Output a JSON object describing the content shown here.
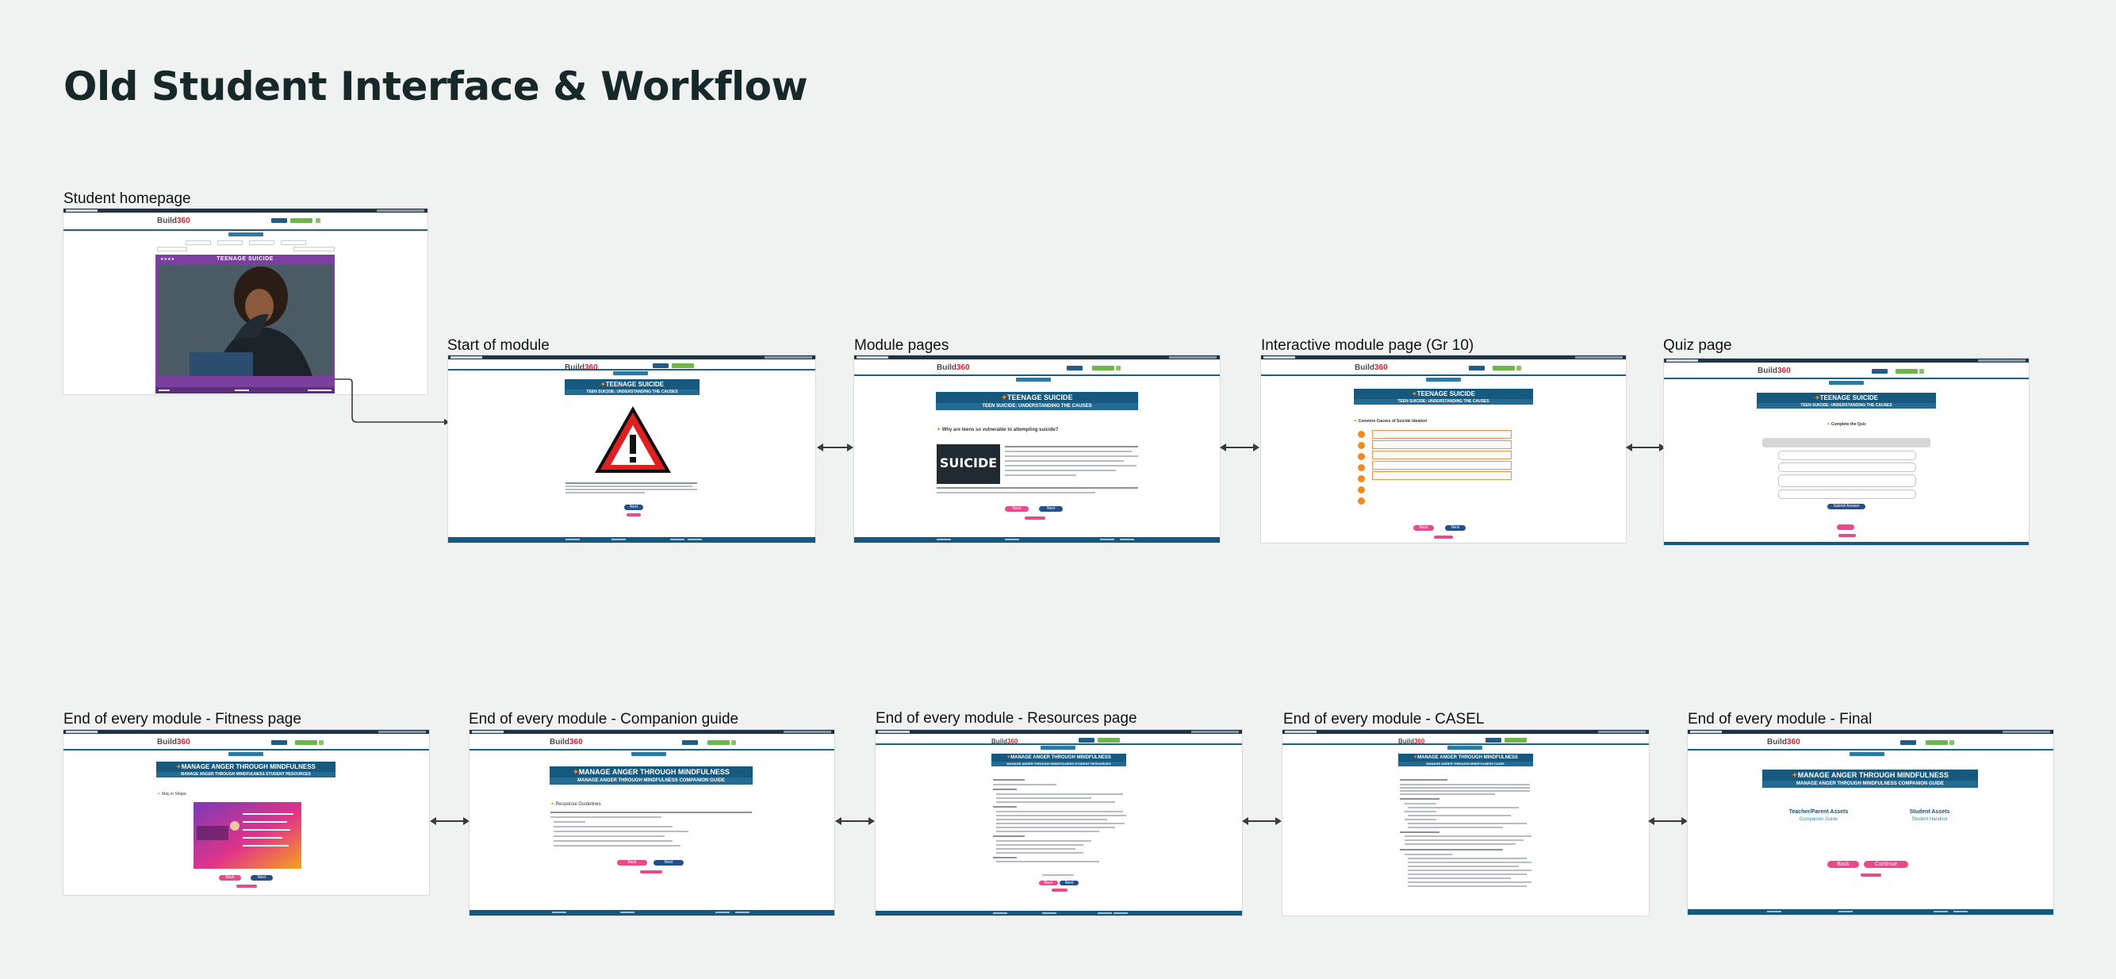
{
  "page": {
    "title": "Old Student Interface & Workflow"
  },
  "frames": [
    {
      "id": "student-homepage",
      "label": "Student homepage",
      "banner": "TEENAGE SUICIDE"
    },
    {
      "id": "start-of-module",
      "label": "Start of module",
      "banner": "TEENAGE SUICIDE",
      "sub": "TEEN SUICIDE: UNDERSTANDING THE CAUSES",
      "nav": [
        "Back",
        "Next"
      ]
    },
    {
      "id": "module-pages",
      "label": "Module pages",
      "banner": "TEENAGE SUICIDE",
      "sub": "TEEN SUICIDE: UNDERSTANDING THE CAUSES",
      "question": "Why are teens so vulnerable to attempting suicide?",
      "image_word": "SUICIDE",
      "nav": [
        "Back",
        "Next"
      ]
    },
    {
      "id": "interactive-module-page",
      "label": "Interactive module page (Gr 10)",
      "banner": "TEENAGE SUICIDE",
      "sub": "TEEN SUICIDE: UNDERSTANDING THE CAUSES",
      "heading": "Common Causes of Suicide Ideation",
      "nav": [
        "Back",
        "Next"
      ]
    },
    {
      "id": "quiz-page",
      "label": "Quiz page",
      "banner": "TEENAGE SUICIDE",
      "sub": "TEEN SUICIDE: UNDERSTANDING THE CAUSES",
      "heading": "Complete the Quiz",
      "submit": "Submit Answer"
    },
    {
      "id": "fitness-page",
      "label": "End of every module - Fitness page",
      "banner": "MANAGE ANGER THROUGH MINDFULNESS",
      "sub": "MANAGE ANGER THROUGH MINDFULNESS STUDENT RESOURCES",
      "heading": "Stay in Shape",
      "nav": [
        "Back",
        "Next"
      ]
    },
    {
      "id": "companion-guide",
      "label": "End of every module - Companion guide",
      "banner": "MANAGE ANGER THROUGH MINDFULNESS",
      "sub": "MANAGE ANGER THROUGH MINDFULNESS COMPANION GUIDE",
      "heading": "Response Guidelines",
      "nav": [
        "Back",
        "Next"
      ]
    },
    {
      "id": "resources-page",
      "label": "End of every module - Resources page",
      "banner": "MANAGE ANGER THROUGH MINDFULNESS",
      "sub": "MANAGE ANGER THROUGH MINDFULNESS STUDENT RESOURCES",
      "nav": [
        "Back",
        "Next"
      ]
    },
    {
      "id": "casel",
      "label": "End of every module - CASEL",
      "banner": "MANAGE ANGER THROUGH MINDFULNESS",
      "sub": "MANAGE ANGER THROUGH MINDFULNESS CASEL"
    },
    {
      "id": "final",
      "label": "End of every module - Final",
      "banner": "MANAGE ANGER THROUGH MINDFULNESS",
      "sub": "MANAGE ANGER THROUGH MINDFULNESS COMPANION GUIDE",
      "teacher_title": "Teacher/Parent Assets",
      "teacher_link": "Companion Guide",
      "student_title": "Student Assets",
      "student_link": "Student Handout",
      "nav": [
        "Back",
        "Continue"
      ]
    }
  ],
  "brand": {
    "logo_a": "Build",
    "logo_b": "360"
  },
  "colors": {
    "banner": "#17587e",
    "accent": "#f08a24",
    "back": "#e84a8c",
    "next": "#23508a",
    "purple": "#7b3f9e"
  }
}
